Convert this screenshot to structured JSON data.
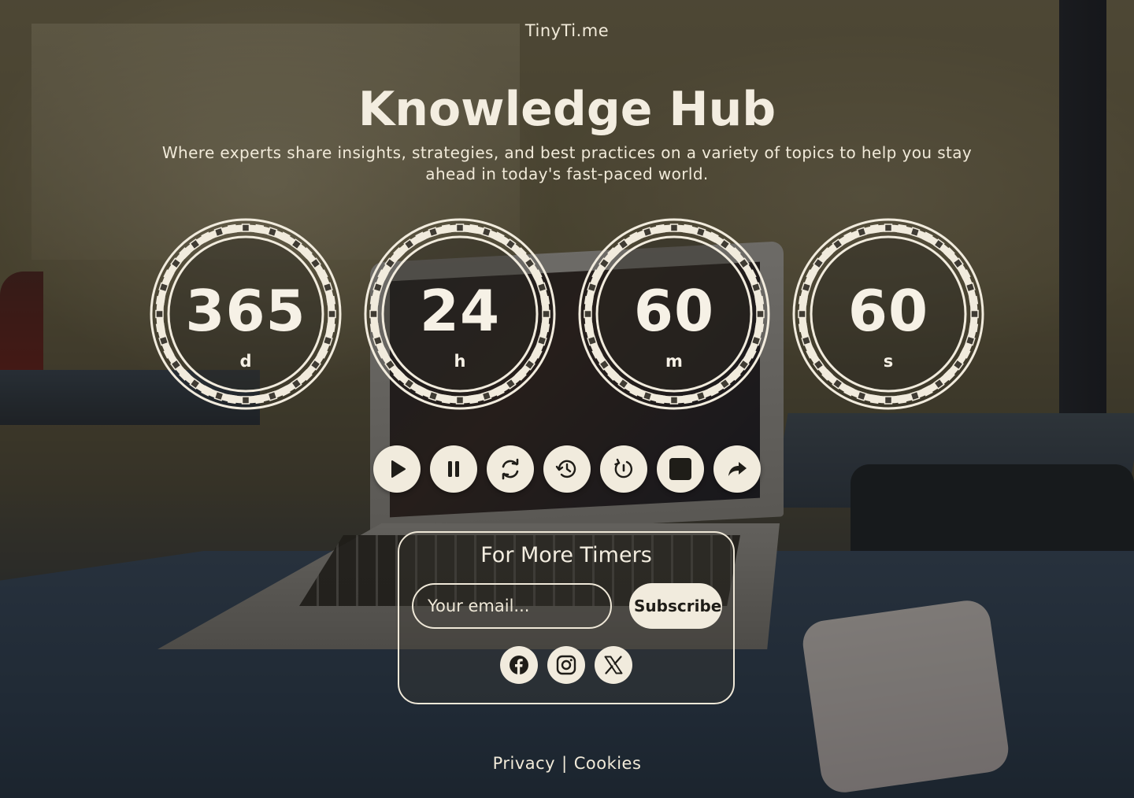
{
  "brand": "TinyTi.me",
  "header": {
    "title": "Knowledge Hub",
    "subtitle": "Where experts share insights, strategies, and best practices on a variety of topics to help you stay ahead in today's fast-paced world."
  },
  "timer": {
    "days": {
      "value": "365",
      "unit": "d"
    },
    "hours": {
      "value": "24",
      "unit": "h"
    },
    "minutes": {
      "value": "60",
      "unit": "m"
    },
    "seconds": {
      "value": "60",
      "unit": "s"
    }
  },
  "controls": {
    "icons": [
      "play-icon",
      "pause-icon",
      "refresh-icon",
      "history-icon",
      "reset-icon",
      "stop-icon",
      "share-icon"
    ]
  },
  "subscribe": {
    "title": "For More Timers",
    "email_placeholder": "Your email...",
    "button_label": "Subscribe",
    "socials": [
      "facebook-icon",
      "instagram-icon",
      "x-icon"
    ]
  },
  "footer": {
    "privacy": "Privacy",
    "separator": "|",
    "cookies": "Cookies"
  },
  "colors": {
    "accent": "#f1ebdd",
    "text": "#f3ede0",
    "overlay": "#14100885"
  }
}
